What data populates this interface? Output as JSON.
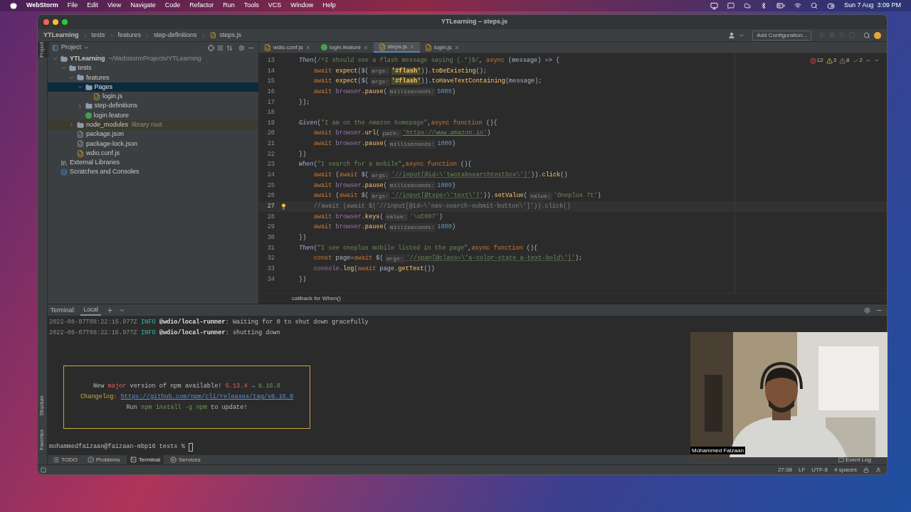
{
  "menubar": {
    "app": "WebStorm",
    "items": [
      "File",
      "Edit",
      "View",
      "Navigate",
      "Code",
      "Refactor",
      "Run",
      "Tools",
      "VCS",
      "Window",
      "Help"
    ],
    "clock": "Sun 7 Aug  3:09 PM"
  },
  "window": {
    "title": "YTLearning – steps.js"
  },
  "breadcrumbs": [
    "YTLearning",
    "tests",
    "features",
    "step-definitions",
    "steps.js"
  ],
  "toolbar": {
    "run_config": "Add Configuration..."
  },
  "left_strip": {
    "top": [
      {
        "label": "Project",
        "selected": true
      }
    ],
    "bottom": [
      {
        "label": "Structure",
        "selected": false
      },
      {
        "label": "Favorites",
        "selected": false
      }
    ]
  },
  "project_panel": {
    "title": "Project",
    "tree": [
      {
        "label": "YTLearning",
        "hint": "~/WebstormProjects/YTLearning",
        "kind": "module",
        "expanded": true,
        "selected": false,
        "children": [
          {
            "label": "tests",
            "kind": "folder",
            "expanded": true,
            "selected": false,
            "children": [
              {
                "label": "features",
                "kind": "folder",
                "expanded": true,
                "selected": false,
                "children": [
                  {
                    "label": "Pages",
                    "kind": "folder",
                    "expanded": true,
                    "selected": true,
                    "children": [
                      {
                        "label": "login.js",
                        "kind": "js",
                        "selected": false
                      }
                    ]
                  },
                  {
                    "label": "step-definitions",
                    "kind": "folder",
                    "expanded": false,
                    "selected": false
                  },
                  {
                    "label": "login.feature",
                    "kind": "feature",
                    "selected": false
                  }
                ]
              },
              {
                "label": "node_modules",
                "hint": "library root",
                "kind": "library",
                "expanded": false,
                "selected": false
              },
              {
                "label": "package.json",
                "kind": "json",
                "selected": false
              },
              {
                "label": "package-lock.json",
                "kind": "json",
                "selected": false
              },
              {
                "label": "wdio.conf.js",
                "kind": "js",
                "selected": false
              }
            ]
          }
        ]
      },
      {
        "label": "External Libraries",
        "kind": "libs",
        "selected": false
      },
      {
        "label": "Scratches and Consoles",
        "kind": "scratches",
        "selected": false
      }
    ]
  },
  "editor_tabs": [
    {
      "label": "wdio.conf.js",
      "kind": "js",
      "selected": false
    },
    {
      "label": "login.feature",
      "kind": "feature",
      "selected": false
    },
    {
      "label": "steps.js",
      "kind": "js",
      "selected": true
    },
    {
      "label": "login.js",
      "kind": "js",
      "selected": false
    }
  ],
  "inspections": [
    {
      "kind": "error",
      "count": "12"
    },
    {
      "kind": "warning",
      "count": "3"
    },
    {
      "kind": "weak",
      "count": "8"
    },
    {
      "kind": "ok",
      "count": "2"
    }
  ],
  "code": [
    {
      "number": "13",
      "current": false,
      "bulb": false,
      "tokens": [
        {
          "text": "Then",
          "kind": "step"
        },
        {
          "text": "(",
          "kind": "plain"
        },
        {
          "text": "/^I should see a flash message saying (.*)$/",
          "kind": "str"
        },
        {
          "text": ", ",
          "kind": "plain"
        },
        {
          "text": "async",
          "kind": "kw"
        },
        {
          "text": " (message) => {",
          "kind": "plain"
        }
      ]
    },
    {
      "number": "14",
      "current": false,
      "bulb": false,
      "tokens": [
        {
          "text": "    await ",
          "kind": "kw"
        },
        {
          "text": "expect",
          "kind": "method"
        },
        {
          "text": "($(",
          "kind": "plain"
        },
        {
          "text": "args:",
          "kind": "hint"
        },
        {
          "text": "'#flash'",
          "kind": "sel"
        },
        {
          "text": ")).",
          "kind": "plain"
        },
        {
          "text": "toBeExisting",
          "kind": "method"
        },
        {
          "text": "();",
          "kind": "plain"
        }
      ]
    },
    {
      "number": "15",
      "current": false,
      "bulb": false,
      "tokens": [
        {
          "text": "    await ",
          "kind": "kw"
        },
        {
          "text": "expect",
          "kind": "method"
        },
        {
          "text": "($(",
          "kind": "plain"
        },
        {
          "text": "args:",
          "kind": "hint"
        },
        {
          "text": "'#flash'",
          "kind": "sel"
        },
        {
          "text": ")).",
          "kind": "plain"
        },
        {
          "text": "toHaveTextContaining",
          "kind": "method"
        },
        {
          "text": "(message);",
          "kind": "plain"
        }
      ]
    },
    {
      "number": "16",
      "current": false,
      "bulb": false,
      "tokens": [
        {
          "text": "    await ",
          "kind": "kw"
        },
        {
          "text": "browser",
          "kind": "ident"
        },
        {
          "text": ".",
          "kind": "plain"
        },
        {
          "text": "pause",
          "kind": "method"
        },
        {
          "text": "(",
          "kind": "plain"
        },
        {
          "text": "milliseconds:",
          "kind": "hint"
        },
        {
          "text": "5000",
          "kind": "num"
        },
        {
          "text": ")",
          "kind": "plain"
        }
      ]
    },
    {
      "number": "17",
      "current": false,
      "bulb": false,
      "tokens": [
        {
          "text": "});",
          "kind": "plain"
        }
      ]
    },
    {
      "number": "18",
      "current": false,
      "bulb": false
    },
    {
      "number": "19",
      "current": false,
      "bulb": false,
      "tokens": [
        {
          "text": "Given",
          "kind": "step"
        },
        {
          "text": "(",
          "kind": "plain"
        },
        {
          "text": "\"I am on the Amazon homepage\"",
          "kind": "str"
        },
        {
          "text": ",",
          "kind": "plain"
        },
        {
          "text": "async function",
          "kind": "kw"
        },
        {
          "text": " (){",
          "kind": "plain"
        }
      ]
    },
    {
      "number": "20",
      "current": false,
      "bulb": false,
      "tokens": [
        {
          "text": "    await ",
          "kind": "kw"
        },
        {
          "text": "browser",
          "kind": "ident"
        },
        {
          "text": ".",
          "kind": "plain"
        },
        {
          "text": "url",
          "kind": "method"
        },
        {
          "text": "(",
          "kind": "plain"
        },
        {
          "text": "path:",
          "kind": "hint"
        },
        {
          "text": "'https://www.amazon.in'",
          "kind": "url"
        },
        {
          "text": ")",
          "kind": "plain"
        }
      ]
    },
    {
      "number": "21",
      "current": false,
      "bulb": false,
      "tokens": [
        {
          "text": "    await ",
          "kind": "kw"
        },
        {
          "text": "browser",
          "kind": "ident"
        },
        {
          "text": ".",
          "kind": "plain"
        },
        {
          "text": "pause",
          "kind": "method"
        },
        {
          "text": "(",
          "kind": "plain"
        },
        {
          "text": "milliseconds:",
          "kind": "hint"
        },
        {
          "text": "1000",
          "kind": "num"
        },
        {
          "text": ")",
          "kind": "plain"
        }
      ]
    },
    {
      "number": "22",
      "current": false,
      "bulb": false,
      "tokens": [
        {
          "text": "})",
          "kind": "plain"
        }
      ]
    },
    {
      "number": "23",
      "current": false,
      "bulb": false,
      "tokens": [
        {
          "text": "When",
          "kind": "step"
        },
        {
          "text": "(",
          "kind": "plain"
        },
        {
          "text": "\"I search for a mobile\"",
          "kind": "str"
        },
        {
          "text": ",",
          "kind": "plain"
        },
        {
          "text": "async function",
          "kind": "kw"
        },
        {
          "text": " (){",
          "kind": "plain"
        }
      ]
    },
    {
      "number": "24",
      "current": false,
      "bulb": false,
      "tokens": [
        {
          "text": "    await ",
          "kind": "kw"
        },
        {
          "text": "(",
          "kind": "plain"
        },
        {
          "text": "await ",
          "kind": "kw"
        },
        {
          "text": "$(",
          "kind": "plain"
        },
        {
          "text": "args:",
          "kind": "hint"
        },
        {
          "text": "'//input[@id=\\'twotabsearchtextbox\\']'",
          "kind": "xpath"
        },
        {
          "text": ")).",
          "kind": "plain"
        },
        {
          "text": "click",
          "kind": "method"
        },
        {
          "text": "()",
          "kind": "plain"
        }
      ]
    },
    {
      "number": "25",
      "current": false,
      "bulb": false,
      "tokens": [
        {
          "text": "    await ",
          "kind": "kw"
        },
        {
          "text": "browser",
          "kind": "ident"
        },
        {
          "text": ".",
          "kind": "plain"
        },
        {
          "text": "pause",
          "kind": "method"
        },
        {
          "text": "(",
          "kind": "plain"
        },
        {
          "text": "milliseconds:",
          "kind": "hint"
        },
        {
          "text": "1000",
          "kind": "num"
        },
        {
          "text": ")",
          "kind": "plain"
        }
      ]
    },
    {
      "number": "26",
      "current": false,
      "bulb": false,
      "tokens": [
        {
          "text": "    await ",
          "kind": "kw"
        },
        {
          "text": "(",
          "kind": "plain"
        },
        {
          "text": "await ",
          "kind": "kw"
        },
        {
          "text": "$(",
          "kind": "plain"
        },
        {
          "text": "args:",
          "kind": "hint"
        },
        {
          "text": "'//input[@type=\\'text\\']'",
          "kind": "xpath"
        },
        {
          "text": ")).",
          "kind": "plain"
        },
        {
          "text": "setValue",
          "kind": "method"
        },
        {
          "text": "(",
          "kind": "plain"
        },
        {
          "text": "value:",
          "kind": "hint"
        },
        {
          "text": "'Oneplus 7t'",
          "kind": "str"
        },
        {
          "text": ")",
          "kind": "plain"
        }
      ]
    },
    {
      "number": "27",
      "current": true,
      "bulb": true,
      "tokens": [
        {
          "text": "    //await (await $('//input[@id=\\'nav-search-submit-button\\']')).click()",
          "kind": "comment"
        }
      ]
    },
    {
      "number": "28",
      "current": false,
      "bulb": false,
      "tokens": [
        {
          "text": "    await ",
          "kind": "kw"
        },
        {
          "text": "browser",
          "kind": "ident"
        },
        {
          "text": ".",
          "kind": "plain"
        },
        {
          "text": "keys",
          "kind": "method"
        },
        {
          "text": "(",
          "kind": "plain"
        },
        {
          "text": "value:",
          "kind": "hint"
        },
        {
          "text": "'\\uE007'",
          "kind": "str"
        },
        {
          "text": ")",
          "kind": "plain"
        }
      ]
    },
    {
      "number": "29",
      "current": false,
      "bulb": false,
      "tokens": [
        {
          "text": "    await ",
          "kind": "kw"
        },
        {
          "text": "browser",
          "kind": "ident"
        },
        {
          "text": ".",
          "kind": "plain"
        },
        {
          "text": "pause",
          "kind": "method"
        },
        {
          "text": "(",
          "kind": "plain"
        },
        {
          "text": "milliseconds:",
          "kind": "hint"
        },
        {
          "text": "1000",
          "kind": "num"
        },
        {
          "text": ")",
          "kind": "plain"
        }
      ]
    },
    {
      "number": "30",
      "current": false,
      "bulb": false,
      "tokens": [
        {
          "text": "})",
          "kind": "plain"
        }
      ]
    },
    {
      "number": "31",
      "current": false,
      "bulb": false,
      "tokens": [
        {
          "text": "Then",
          "kind": "step"
        },
        {
          "text": "(",
          "kind": "plain"
        },
        {
          "text": "\"I see oneplus mobile listed in the page\"",
          "kind": "str"
        },
        {
          "text": ",",
          "kind": "plain"
        },
        {
          "text": "async function",
          "kind": "kw"
        },
        {
          "text": " (){",
          "kind": "plain"
        }
      ]
    },
    {
      "number": "32",
      "current": false,
      "bulb": false,
      "tokens": [
        {
          "text": "    const ",
          "kind": "kw"
        },
        {
          "text": "page=",
          "kind": "plain"
        },
        {
          "text": "await ",
          "kind": "kw"
        },
        {
          "text": "$(",
          "kind": "plain"
        },
        {
          "text": "args:",
          "kind": "hint"
        },
        {
          "text": "'//span[@class=\\'a-color-state a-text-bold\\']'",
          "kind": "xpath"
        },
        {
          "text": ");",
          "kind": "plain"
        }
      ]
    },
    {
      "number": "33",
      "current": false,
      "bulb": false,
      "tokens": [
        {
          "text": "    console",
          "kind": "ident"
        },
        {
          "text": ".",
          "kind": "plain"
        },
        {
          "text": "log",
          "kind": "method"
        },
        {
          "text": "(",
          "kind": "plain"
        },
        {
          "text": "await ",
          "kind": "kw"
        },
        {
          "text": "page.",
          "kind": "plain"
        },
        {
          "text": "getText",
          "kind": "method"
        },
        {
          "text": "())",
          "kind": "plain"
        }
      ]
    },
    {
      "number": "34",
      "current": false,
      "bulb": false,
      "tokens": [
        {
          "text": "})",
          "kind": "plain"
        }
      ]
    }
  ],
  "editor_footer": "callback for When()",
  "terminal": {
    "title": "Terminal:",
    "tabs": [
      {
        "label": "Local",
        "selected": true
      }
    ],
    "lines": [
      {
        "tokens": [
          {
            "text": "2022-08-07T08:22:16.977Z ",
            "kind": "dim"
          },
          {
            "text": "INFO ",
            "kind": "info"
          },
          {
            "text": "@wdio/local-runner",
            "kind": "bold"
          },
          {
            "text": ": Waiting for 0 to shut down gracefully",
            "kind": "plain"
          }
        ]
      },
      {
        "tokens": [
          {
            "text": "2022-08-07T08:22:16.977Z ",
            "kind": "dim"
          },
          {
            "text": "INFO ",
            "kind": "info"
          },
          {
            "text": "@wdio/local-runner",
            "kind": "bold"
          },
          {
            "text": ": shutting down",
            "kind": "plain"
          }
        ]
      }
    ],
    "notice": [
      {
        "tokens": [
          {
            "text": "New ",
            "kind": "plain"
          },
          {
            "text": "major",
            "kind": "red"
          },
          {
            "text": " version of npm available! ",
            "kind": "plain"
          },
          {
            "text": "6.13.4",
            "kind": "red"
          },
          {
            "text": " → ",
            "kind": "plain"
          },
          {
            "text": "8.16.0",
            "kind": "green"
          }
        ]
      },
      {
        "tokens": [
          {
            "text": "Changelog: ",
            "kind": "yellow"
          },
          {
            "text": "https://github.com/npm/cli/releases/tag/v8.16.0",
            "kind": "link"
          }
        ]
      },
      {
        "tokens": [
          {
            "text": "Run ",
            "kind": "plain"
          },
          {
            "text": "npm install -g npm",
            "kind": "green"
          },
          {
            "text": " to update!",
            "kind": "plain"
          }
        ]
      }
    ],
    "prompt": "mohammedfaizaan@faizaan-mbp16 tests %"
  },
  "tool_windows": [
    {
      "label": "TODO",
      "kind": "todo",
      "selected": false
    },
    {
      "label": "Problems",
      "kind": "problems",
      "selected": false
    },
    {
      "label": "Terminal",
      "kind": "terminal",
      "selected": true
    },
    {
      "label": "Services",
      "kind": "services",
      "selected": false
    }
  ],
  "status": {
    "event_log": "Event Log",
    "items": [
      "27:38",
      "LF",
      "UTF-8",
      "4 spaces"
    ]
  },
  "webcam": {
    "kind": "picture",
    "caption": "Mohammed Faizaan"
  }
}
